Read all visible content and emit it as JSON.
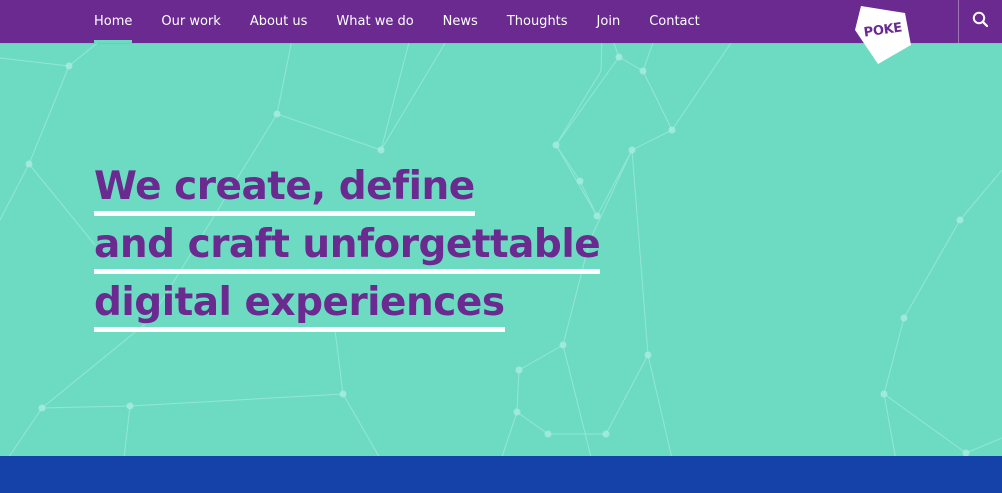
{
  "colors": {
    "hero_background": "#6ddbc2",
    "nav_background": "#6a2a90",
    "headline": "#6a2a90",
    "underline": "#ffffff",
    "bottom_band": "#1442a8"
  },
  "nav": {
    "items": [
      {
        "label": "Home",
        "active": true
      },
      {
        "label": "Our work"
      },
      {
        "label": "About us"
      },
      {
        "label": "What we do"
      },
      {
        "label": "News"
      },
      {
        "label": "Thoughts"
      },
      {
        "label": "Join"
      },
      {
        "label": "Contact"
      }
    ]
  },
  "brand": {
    "logo_text": "POKE"
  },
  "search": {
    "icon": "search-icon"
  },
  "hero": {
    "lines": [
      "We create, define",
      "and craft unforgettable",
      "digital experiences"
    ]
  }
}
